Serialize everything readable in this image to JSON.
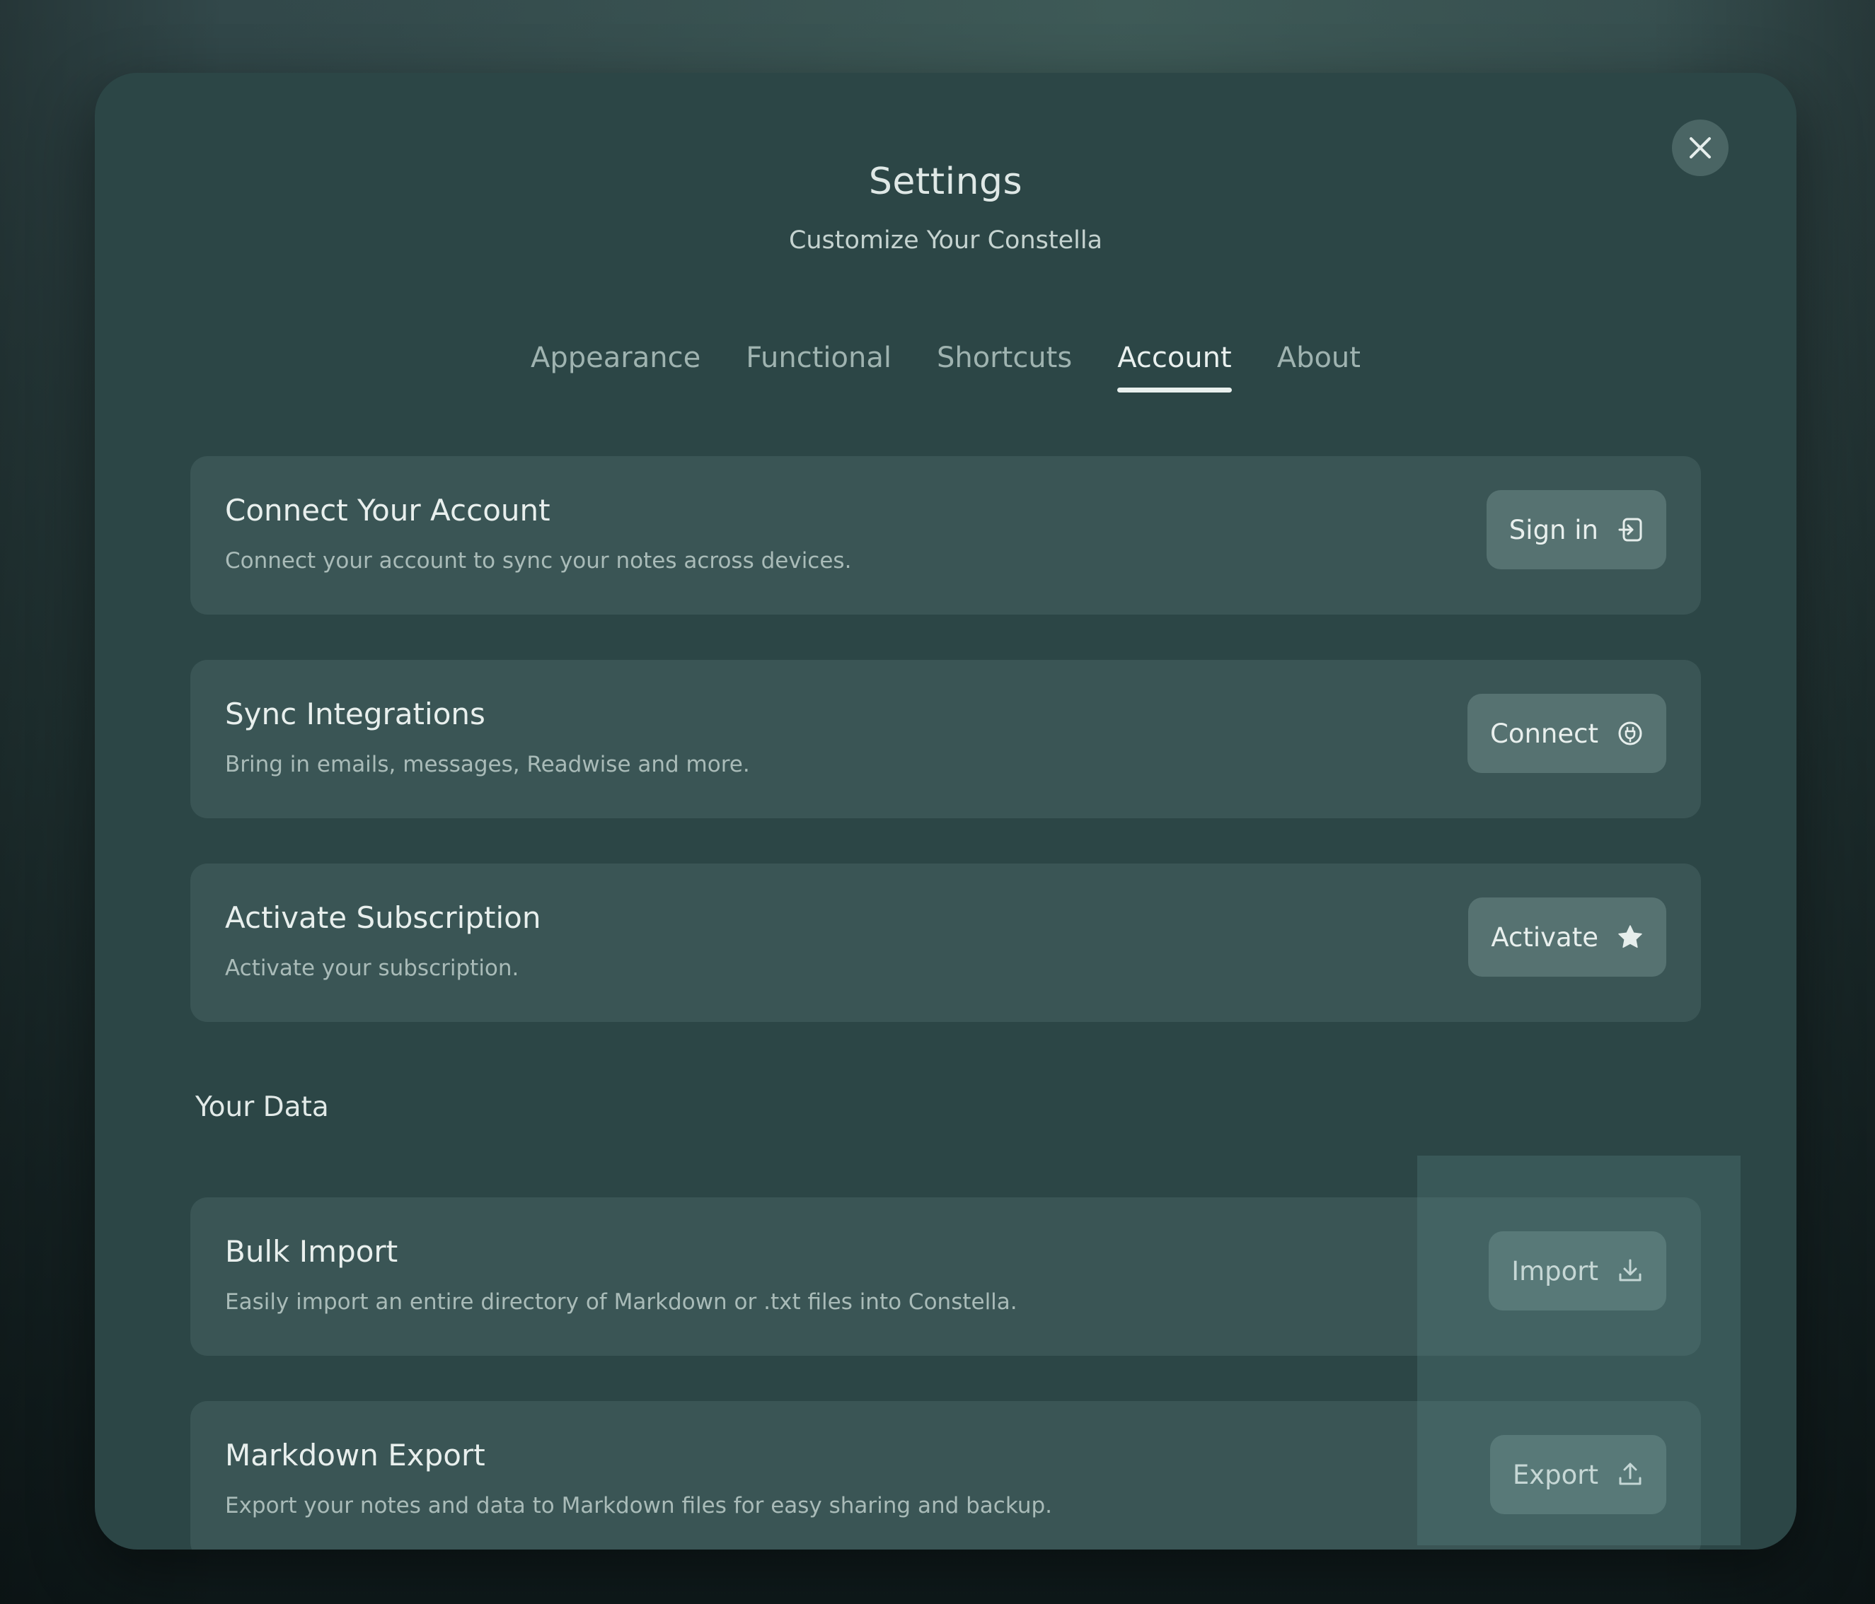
{
  "header": {
    "title": "Settings",
    "subtitle": "Customize Your Constella"
  },
  "tabs": [
    {
      "label": "Appearance",
      "active": false
    },
    {
      "label": "Functional",
      "active": false
    },
    {
      "label": "Shortcuts",
      "active": false
    },
    {
      "label": "Account",
      "active": true
    },
    {
      "label": "About",
      "active": false
    }
  ],
  "account": {
    "connect": {
      "title": "Connect Your Account",
      "description": "Connect your account to sync your notes across devices.",
      "button_label": "Sign in",
      "icon": "sign-in-icon"
    },
    "sync": {
      "title": "Sync Integrations",
      "description": "Bring in emails, messages, Readwise and more.",
      "button_label": "Connect",
      "icon": "plug-icon"
    },
    "subscription": {
      "title": "Activate Subscription",
      "description": "Activate your subscription.",
      "button_label": "Activate",
      "icon": "star-icon"
    }
  },
  "your_data": {
    "heading": "Your Data",
    "import": {
      "title": "Bulk Import",
      "description": "Easily import an entire directory of Markdown or .txt files into Constella.",
      "button_label": "Import",
      "icon": "download-icon"
    },
    "export": {
      "title": "Markdown Export",
      "description": "Export your notes and data to Markdown files for easy sharing and backup.",
      "button_label": "Export",
      "icon": "upload-icon"
    }
  },
  "colors": {
    "modal_background": "#2c4646",
    "card_background": "#3a5555",
    "button_background": "#567271",
    "text_primary": "#e8efed",
    "text_secondary": "#a9bbb8"
  }
}
